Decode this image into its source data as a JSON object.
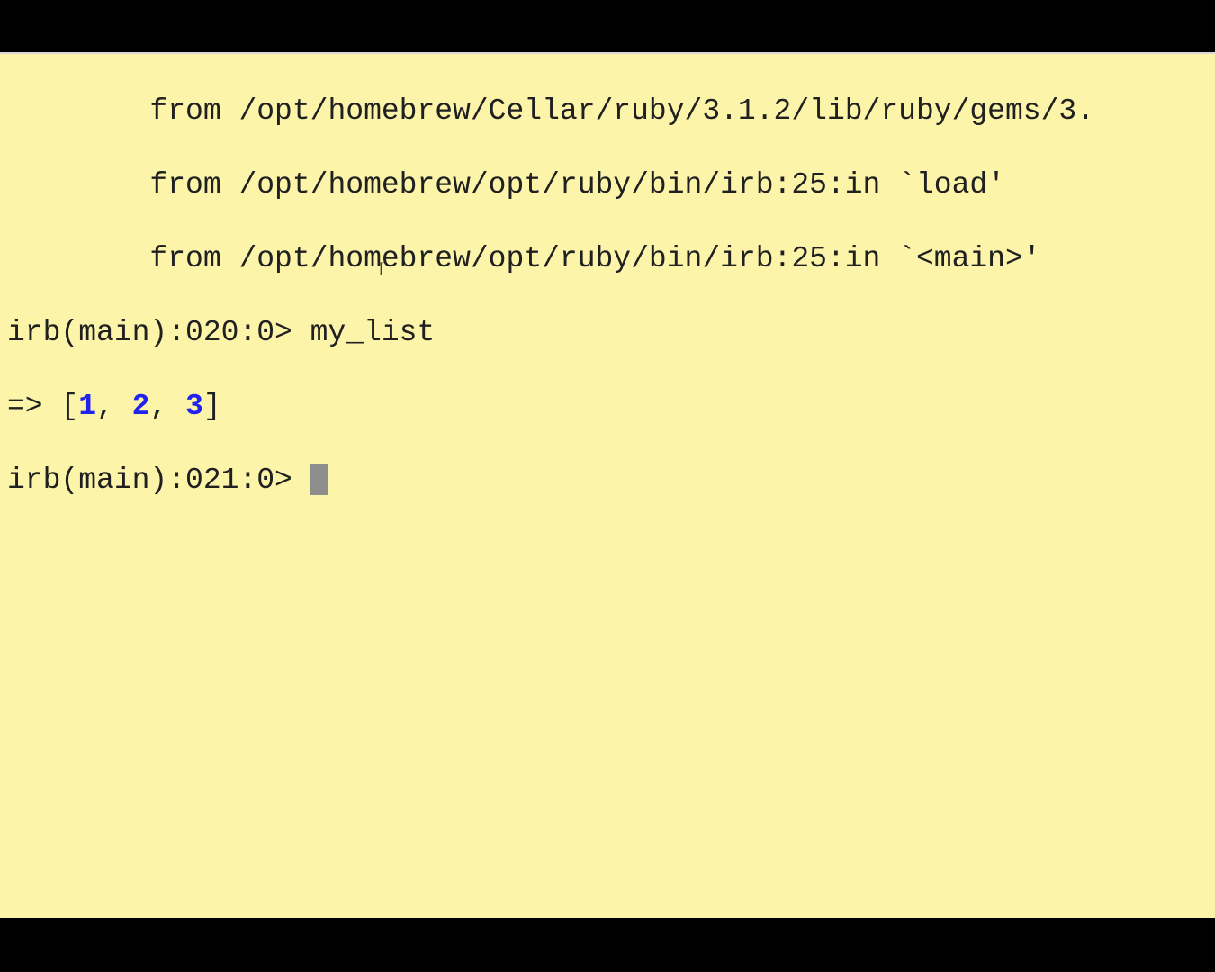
{
  "terminal": {
    "traceback": {
      "line1": "        from /opt/homebrew/Cellar/ruby/3.1.2/lib/ruby/gems/3.",
      "line2": "        from /opt/homebrew/opt/ruby/bin/irb:25:in `load'",
      "line3": "        from /opt/homebrew/opt/ruby/bin/irb:25:in `<main>'"
    },
    "prompt1": {
      "prefix": "irb(main):020:0> ",
      "input": "my_list"
    },
    "result": {
      "prefix": "=> [",
      "val1": "1",
      "sep1": ", ",
      "val2": "2",
      "sep2": ", ",
      "val3": "3",
      "suffix": "]"
    },
    "prompt2": {
      "prefix": "irb(main):021:0> "
    }
  }
}
